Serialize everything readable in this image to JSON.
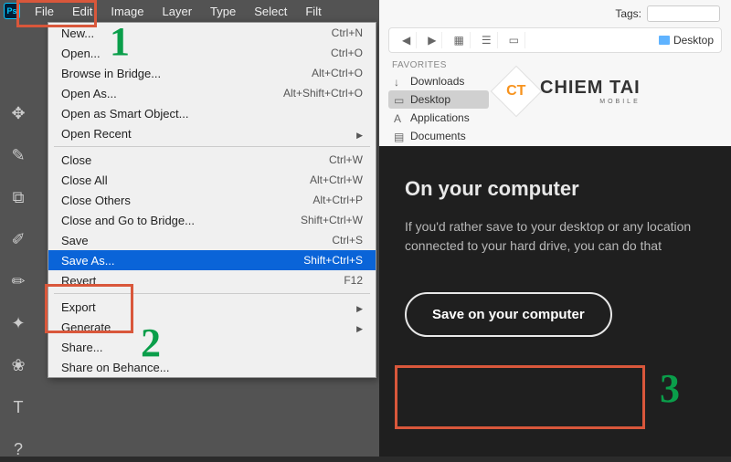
{
  "menubar": {
    "items": [
      "File",
      "Edit",
      "Image",
      "Layer",
      "Type",
      "Select",
      "Filt"
    ]
  },
  "dropdown": {
    "groups": [
      [
        {
          "label": "New...",
          "shortcut": "Ctrl+N"
        },
        {
          "label": "Open...",
          "shortcut": "Ctrl+O"
        },
        {
          "label": "Browse in Bridge...",
          "shortcut": "Alt+Ctrl+O"
        },
        {
          "label": "Open As...",
          "shortcut": "Alt+Shift+Ctrl+O"
        },
        {
          "label": "Open as Smart Object...",
          "shortcut": ""
        },
        {
          "label": "Open Recent",
          "shortcut": "",
          "submenu": true
        }
      ],
      [
        {
          "label": "Close",
          "shortcut": "Ctrl+W"
        },
        {
          "label": "Close All",
          "shortcut": "Alt+Ctrl+W"
        },
        {
          "label": "Close Others",
          "shortcut": "Alt+Ctrl+P"
        },
        {
          "label": "Close and Go to Bridge...",
          "shortcut": "Shift+Ctrl+W"
        },
        {
          "label": "Save",
          "shortcut": "Ctrl+S"
        },
        {
          "label": "Save As...",
          "shortcut": "Shift+Ctrl+S",
          "selected": true
        },
        {
          "label": "Revert",
          "shortcut": "F12"
        }
      ],
      [
        {
          "label": "Export",
          "shortcut": "",
          "submenu": true
        },
        {
          "label": "Generate",
          "shortcut": "",
          "submenu": true
        },
        {
          "label": "Share...",
          "shortcut": ""
        },
        {
          "label": "Share on Behance...",
          "shortcut": ""
        }
      ]
    ]
  },
  "tools": [
    "move",
    "lasso",
    "crop",
    "eyedrop",
    "brush",
    "fx",
    "sponge",
    "text",
    "?"
  ],
  "browser": {
    "tags_label": "Tags:",
    "location": "Desktop",
    "fav_header": "Favorites",
    "favs": [
      {
        "label": "Downloads",
        "icon": "↓"
      },
      {
        "label": "Desktop",
        "icon": "▭",
        "active": true
      },
      {
        "label": "Applications",
        "icon": "A"
      },
      {
        "label": "Documents",
        "icon": "▤"
      }
    ],
    "brand": {
      "mark": "CT",
      "name": "CHIEM TAI",
      "sub": "MOBILE"
    }
  },
  "cloud": {
    "heading": "On your computer",
    "body": "If you'd rather save to your desktop or any location connected to your hard drive, you can do that",
    "button": "Save on your computer"
  },
  "steps": {
    "one": "1",
    "two": "2",
    "three": "3"
  }
}
